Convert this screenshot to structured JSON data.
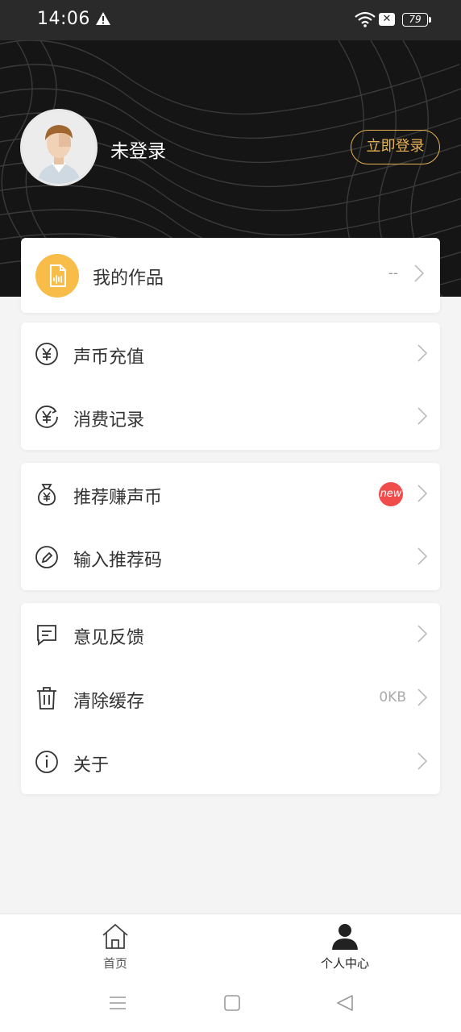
{
  "status_bar": {
    "time": "14:06",
    "battery": "79"
  },
  "profile": {
    "name": "未登录",
    "login_button": "立即登录"
  },
  "works": {
    "label": "我的作品",
    "value": "--"
  },
  "group1": [
    {
      "icon": "yen-circle-icon",
      "label": "声币充值"
    },
    {
      "icon": "yen-record-icon",
      "label": "消费记录"
    }
  ],
  "group2": [
    {
      "icon": "money-bag-icon",
      "label": "推荐赚声币",
      "badge": "new"
    },
    {
      "icon": "pencil-circle-icon",
      "label": "输入推荐码"
    }
  ],
  "group3": [
    {
      "icon": "feedback-icon",
      "label": "意见反馈"
    },
    {
      "icon": "trash-icon",
      "label": "清除缓存",
      "value": "0KB"
    },
    {
      "icon": "info-icon",
      "label": "关于"
    }
  ],
  "bottom_nav": {
    "home": "首页",
    "me": "个人中心"
  },
  "colors": {
    "accent": "#e6b153",
    "works_icon_bg": "#f7bd48",
    "badge": "#f04c4c"
  }
}
